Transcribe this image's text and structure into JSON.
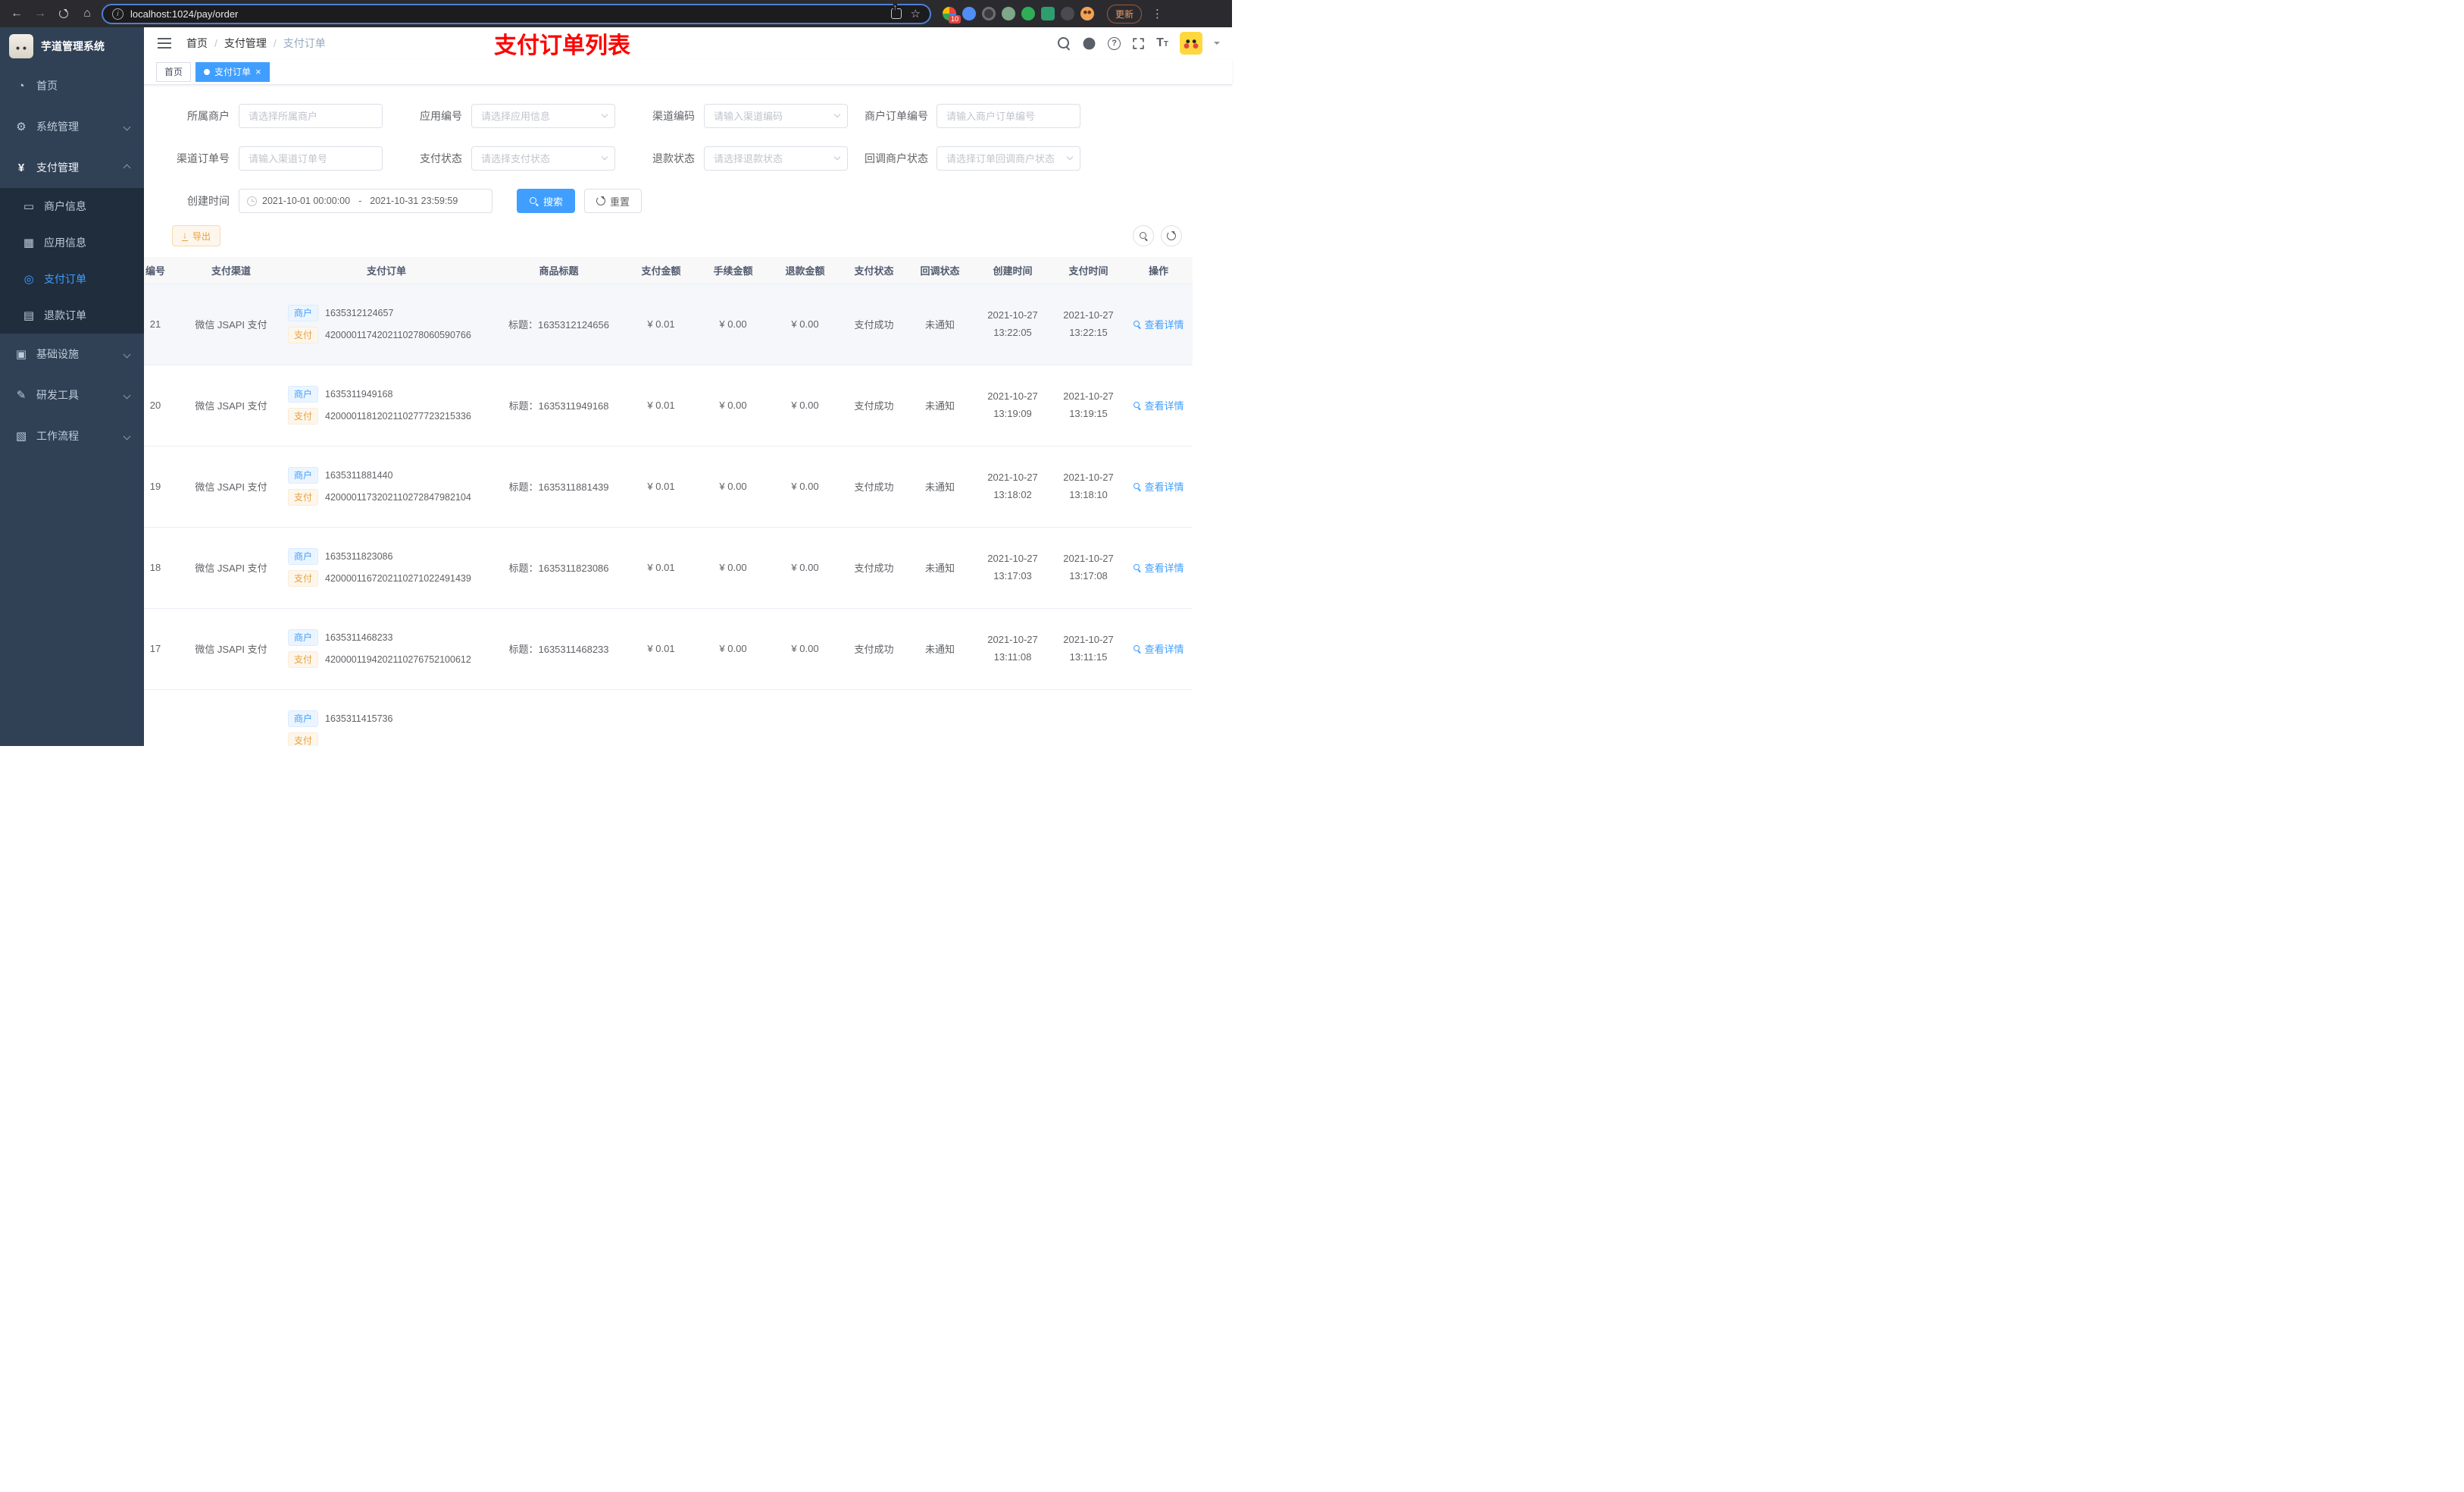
{
  "colors": {
    "accent": "#409eff",
    "warning": "#e6a23c",
    "annotation_red": "#fe0000",
    "sidebar_bg": "#304156",
    "submenu_bg": "#1f2d3d"
  },
  "browser": {
    "url": "localhost:1024/pay/order",
    "update_label": "更新",
    "ext_badge": "10"
  },
  "sidebar": {
    "logo_title": "芋道管理系统",
    "home": "首页",
    "system": "系统管理",
    "payment": "支付管理",
    "merchant_info": "商户信息",
    "app_info": "应用信息",
    "pay_order": "支付订单",
    "refund_order": "退款订单",
    "infra": "基础设施",
    "devtools": "研发工具",
    "workflow": "工作流程"
  },
  "header": {
    "breadcrumb": [
      "首页",
      "支付管理",
      "支付订单"
    ],
    "annotation": "支付订单列表"
  },
  "tabs": {
    "home": "首页",
    "active": "支付订单"
  },
  "filters": {
    "merchant": {
      "label": "所属商户",
      "placeholder": "请选择所属商户"
    },
    "app": {
      "label": "应用编号",
      "placeholder": "请选择应用信息"
    },
    "channel_code": {
      "label": "渠道编码",
      "placeholder": "请输入渠道编码"
    },
    "merchant_order_no": {
      "label": "商户订单编号",
      "placeholder": "请输入商户订单编号"
    },
    "channel_order_no": {
      "label": "渠道订单号",
      "placeholder": "请输入渠道订单号"
    },
    "pay_status": {
      "label": "支付状态",
      "placeholder": "请选择支付状态"
    },
    "refund_status": {
      "label": "退款状态",
      "placeholder": "请选择退款状态"
    },
    "notify_status": {
      "label": "回调商户状态",
      "placeholder": "请选择订单回调商户状态"
    },
    "create_time": {
      "label": "创建时间",
      "start": "2021-10-01 00:00:00",
      "separator": "-",
      "end": "2021-10-31 23:59:59"
    },
    "search_label": "搜索",
    "reset_label": "重置"
  },
  "toolbar": {
    "export_label": "导出"
  },
  "table": {
    "headers": [
      "编号",
      "支付渠道",
      "支付订单",
      "商品标题",
      "支付金额",
      "手续金额",
      "退款金额",
      "支付状态",
      "回调状态",
      "创建时间",
      "支付时间",
      "操作"
    ],
    "merchant_tag": "商户",
    "pay_tag": "支付",
    "action_label": "查看详情",
    "rows": [
      {
        "id": "21",
        "channel": "微信 JSAPI 支付",
        "merchant_no": "1635312124657",
        "pay_no": "4200001174202110278060590766",
        "title": "标题：1635312124656",
        "amount": "¥ 0.01",
        "fee": "¥ 0.00",
        "refund": "¥ 0.00",
        "status": "支付成功",
        "notify": "未通知",
        "create_date": "2021-10-27",
        "create_clock": "13:22:05",
        "pay_date": "2021-10-27",
        "pay_clock": "13:22:15"
      },
      {
        "id": "20",
        "channel": "微信 JSAPI 支付",
        "merchant_no": "1635311949168",
        "pay_no": "4200001181202110277723215336",
        "title": "标题：1635311949168",
        "amount": "¥ 0.01",
        "fee": "¥ 0.00",
        "refund": "¥ 0.00",
        "status": "支付成功",
        "notify": "未通知",
        "create_date": "2021-10-27",
        "create_clock": "13:19:09",
        "pay_date": "2021-10-27",
        "pay_clock": "13:19:15"
      },
      {
        "id": "19",
        "channel": "微信 JSAPI 支付",
        "merchant_no": "1635311881440",
        "pay_no": "4200001173202110272847982104",
        "title": "标题：1635311881439",
        "amount": "¥ 0.01",
        "fee": "¥ 0.00",
        "refund": "¥ 0.00",
        "status": "支付成功",
        "notify": "未通知",
        "create_date": "2021-10-27",
        "create_clock": "13:18:02",
        "pay_date": "2021-10-27",
        "pay_clock": "13:18:10"
      },
      {
        "id": "18",
        "channel": "微信 JSAPI 支付",
        "merchant_no": "1635311823086",
        "pay_no": "4200001167202110271022491439",
        "title": "标题：1635311823086",
        "amount": "¥ 0.01",
        "fee": "¥ 0.00",
        "refund": "¥ 0.00",
        "status": "支付成功",
        "notify": "未通知",
        "create_date": "2021-10-27",
        "create_clock": "13:17:03",
        "pay_date": "2021-10-27",
        "pay_clock": "13:17:08"
      },
      {
        "id": "17",
        "channel": "微信 JSAPI 支付",
        "merchant_no": "1635311468233",
        "pay_no": "4200001194202110276752100612",
        "title": "标题：1635311468233",
        "amount": "¥ 0.01",
        "fee": "¥ 0.00",
        "refund": "¥ 0.00",
        "status": "支付成功",
        "notify": "未通知",
        "create_date": "2021-10-27",
        "create_clock": "13:11:08",
        "pay_date": "2021-10-27",
        "pay_clock": "13:11:15"
      }
    ],
    "partial_row": {
      "merchant_no": "1635311415736"
    }
  }
}
